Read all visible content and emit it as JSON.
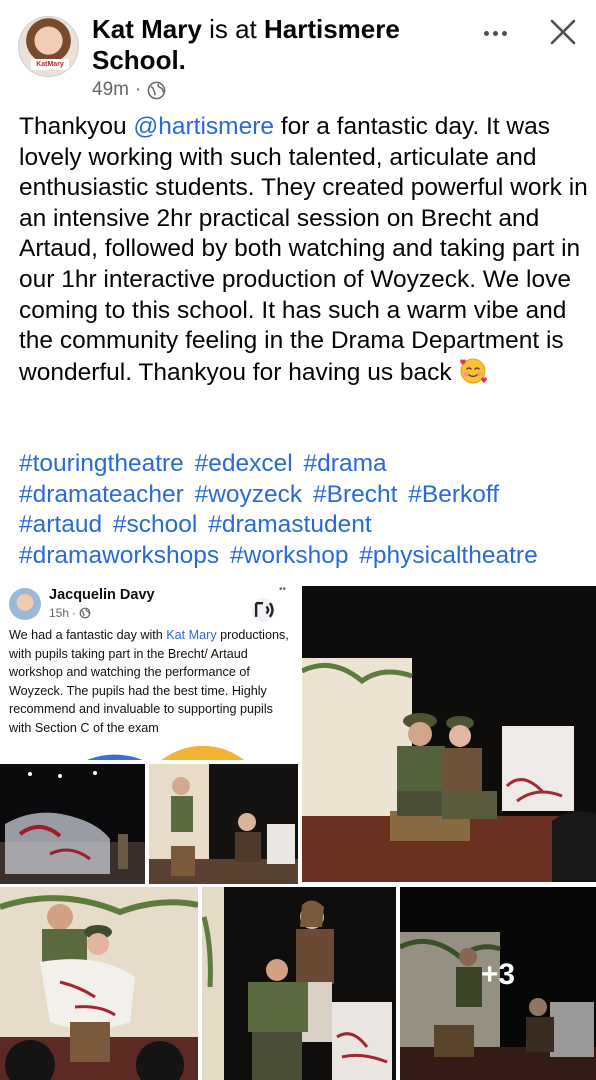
{
  "post": {
    "author": "Kat Mary",
    "action": "is at",
    "place": "Hartismere School.",
    "time": "49m",
    "dot": "·",
    "text_before_mention": "Thankyou ",
    "mention": "@hartismere",
    "text_after_mention": " for a fantastic day. It was lovely working with such talented, articulate and enthusiastic students. They created powerful work in an intensive 2hr practical session on Brecht and Artaud, followed by both watching and taking part in our 1hr interactive production of Woyzeck. We love coming to this school. It has such a warm vibe and the community feeling in the Drama Department is wonderful. Thankyou for having us back ",
    "emoji": "smiling-face-with-hearts",
    "hashtags": [
      "#touringtheatre",
      "#edexcel",
      "#drama",
      "#dramateacher",
      "#woyzeck",
      "#Brecht",
      "#Berkoff",
      "#artaud",
      "#school",
      "#dramastudent",
      "#dramaworkshops",
      "#workshop",
      "#physicaltheatre"
    ],
    "avatar_badge": "KatMary"
  },
  "embedded_card": {
    "name": "Jacquelin Davy",
    "time": "15h",
    "dot": "·",
    "text_before": "We had a fantastic day with ",
    "link": "Kat Mary",
    "text_after": " productions, with pupils taking part in the Brecht/ Artaud workshop and watching the performance of Woyzeck. The pupils had the best time. Highly recommend and invaluable to supporting pupils with Section C of the exam "
  },
  "media": {
    "more_count": "+3"
  },
  "icons": {
    "globe": "globe-icon",
    "more": "more-options-icon",
    "close": "close-icon",
    "sound": "sound-icon"
  },
  "colors": {
    "link_blue": "#2a6ad8",
    "text": "#050505",
    "meta_gray": "#65676b"
  }
}
